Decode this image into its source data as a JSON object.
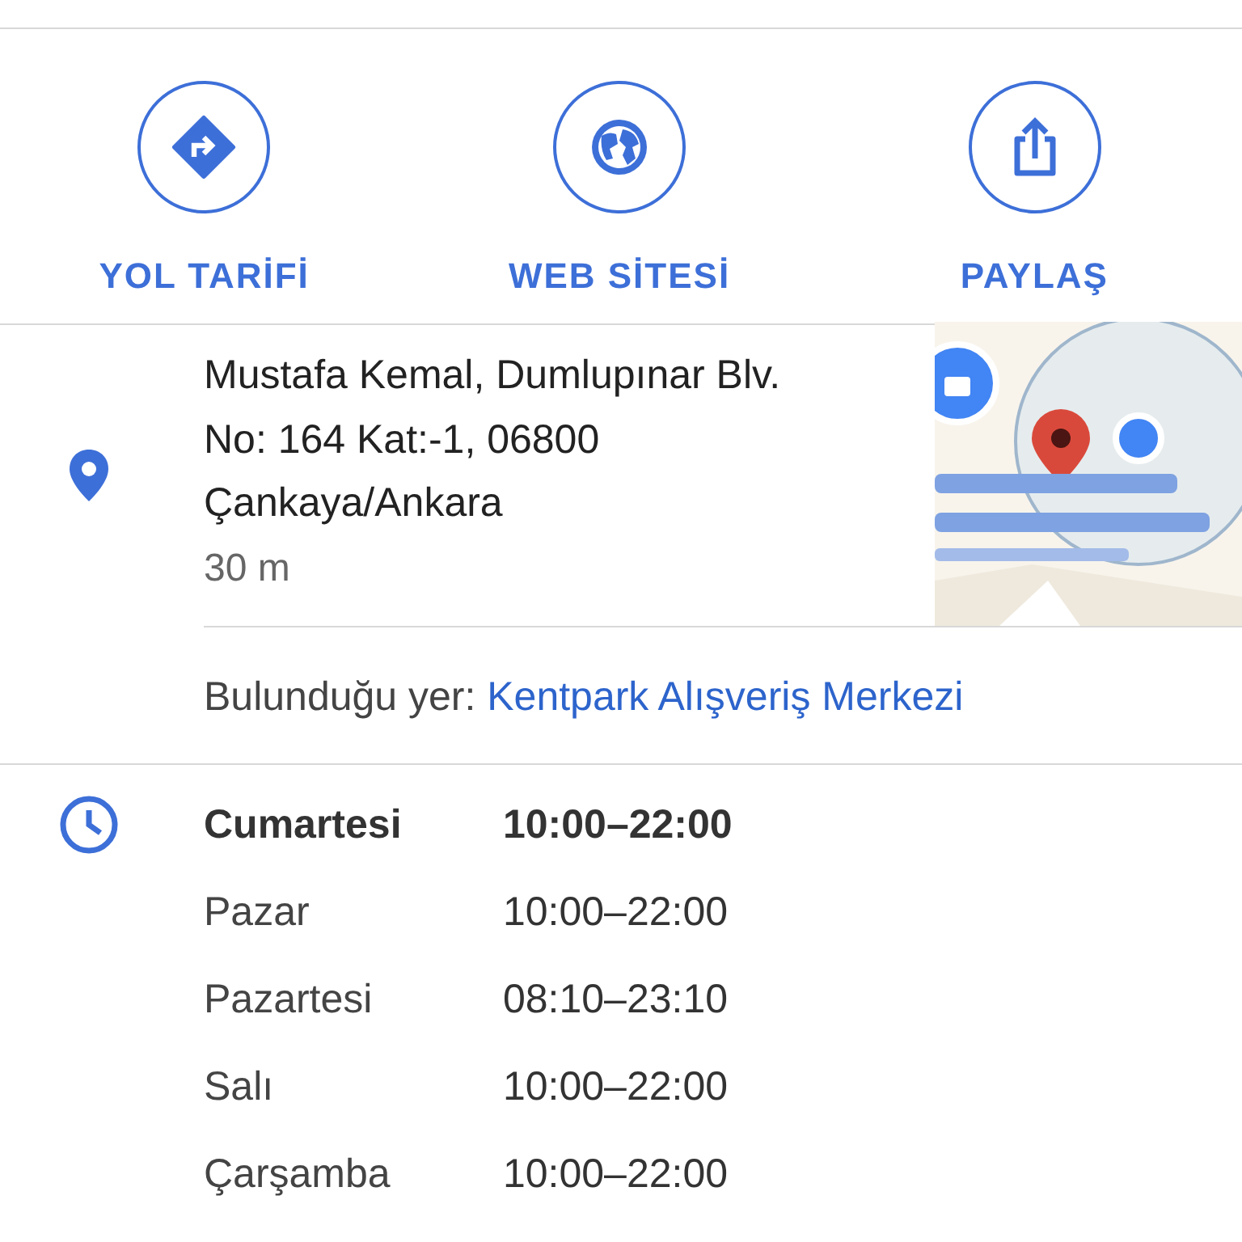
{
  "actions": [
    {
      "kind": "directions",
      "label": "YOL TARİFİ"
    },
    {
      "kind": "website",
      "label": "WEB SİTESİ"
    },
    {
      "kind": "share",
      "label": "PAYLAŞ"
    }
  ],
  "address": {
    "lines": [
      "Mustafa Kemal, Dumlupınar Blv.",
      "No: 164 Kat:-1, 06800",
      "Çankaya/Ankara"
    ],
    "distance": "30 m"
  },
  "located_in": {
    "label": "Bulunduğu yer:",
    "place": "Kentpark Alışveriş Merkezi"
  },
  "hours": [
    {
      "day": "Cumartesi",
      "time": "10:00–22:00",
      "today": true
    },
    {
      "day": "Pazar",
      "time": "10:00–22:00",
      "today": false
    },
    {
      "day": "Pazartesi",
      "time": "08:10–23:10",
      "today": false
    },
    {
      "day": "Salı",
      "time": "10:00–22:00",
      "today": false
    },
    {
      "day": "Çarşamba",
      "time": "10:00–22:00",
      "today": false
    }
  ]
}
